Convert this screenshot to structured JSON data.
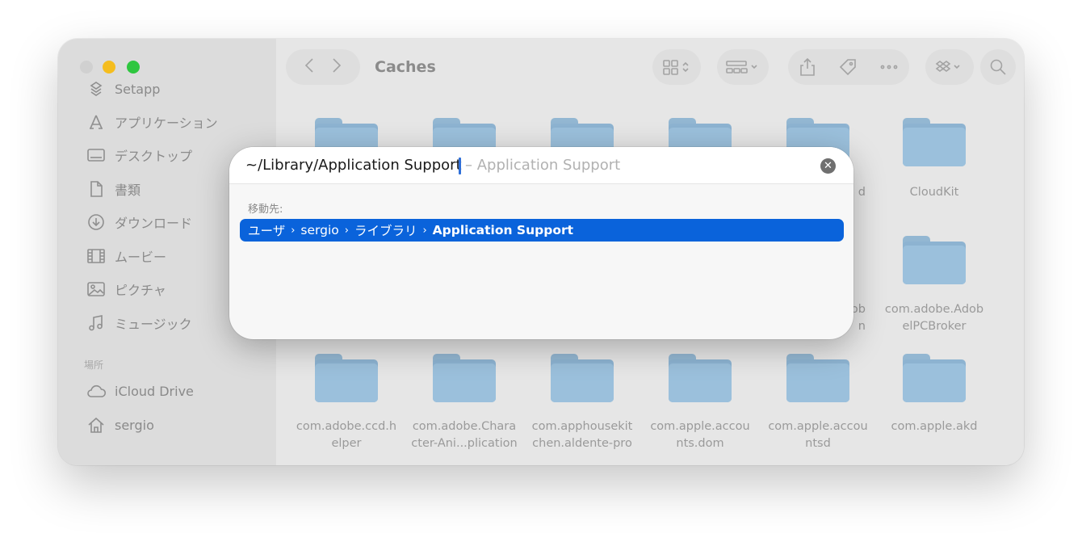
{
  "window": {
    "title": "Caches",
    "sidebar": {
      "items": [
        {
          "label": "Setapp",
          "icon": "setapp-icon"
        },
        {
          "label": "アプリケーション",
          "icon": "applications-icon"
        },
        {
          "label": "デスクトップ",
          "icon": "desktop-icon"
        },
        {
          "label": "書類",
          "icon": "document-icon"
        },
        {
          "label": "ダウンロード",
          "icon": "download-icon"
        },
        {
          "label": "ムービー",
          "icon": "movie-icon"
        },
        {
          "label": "ピクチャ",
          "icon": "picture-icon"
        },
        {
          "label": "ミュージック",
          "icon": "music-icon"
        }
      ],
      "places_heading": "場所",
      "places": [
        {
          "label": "iCloud Drive",
          "icon": "cloud-icon"
        },
        {
          "label": "sergio",
          "icon": "home-icon"
        }
      ]
    },
    "folders_row1": [
      {
        "label": ""
      },
      {
        "label": ""
      },
      {
        "label": ""
      },
      {
        "label": ""
      },
      {
        "label": "d"
      },
      {
        "label": "CloudKit"
      }
    ],
    "folders_row2": [
      {
        "label": "ob\nn"
      },
      {
        "label": "com.adobe.Adob\nelPCBroker"
      }
    ],
    "folders_row3": [
      {
        "label": "com.adobe.ccd.h\nelper"
      },
      {
        "label": "com.adobe.Chara\ncter-Ani...plication"
      },
      {
        "label": "com.apphousekit\nchen.aldente-pro"
      },
      {
        "label": "com.apple.accou\nnts.dom"
      },
      {
        "label": "com.apple.accou\nntsd"
      },
      {
        "label": "com.apple.akd"
      }
    ]
  },
  "go_dialog": {
    "input_value": "~/Library/Application Support",
    "hint": "– Application Support",
    "section_label": "移動先:",
    "result_path": [
      "ユーザ",
      "sergio",
      "ライブラリ",
      "Application Support"
    ],
    "separator": "›"
  },
  "colors": {
    "selection": "#0a63db",
    "folder": "#8db3d1",
    "traffic_min": "#f5bd1e",
    "traffic_max": "#2ec63f"
  }
}
